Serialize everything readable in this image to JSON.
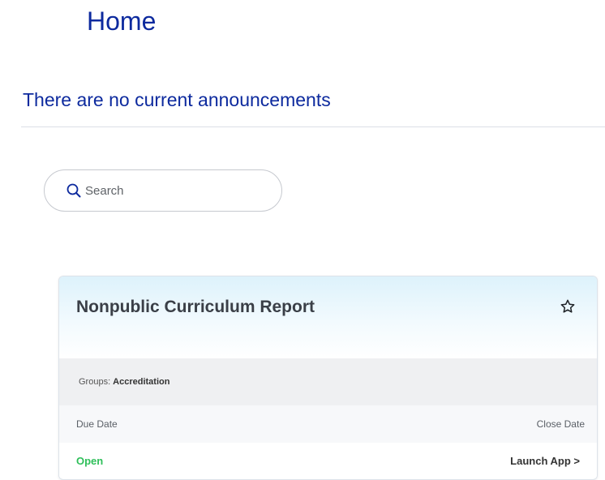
{
  "page": {
    "title": "Home"
  },
  "announcements": {
    "message": "There are no current announcements"
  },
  "search": {
    "placeholder": "Search",
    "value": "",
    "icon": "search-icon"
  },
  "app_card": {
    "title": "Nonpublic Curriculum Report",
    "favorite_icon": "star-outline-icon",
    "groups_label": "Groups:",
    "groups_value": "Accreditation",
    "due_date_label": "Due Date",
    "close_date_label": "Close Date",
    "status": "Open",
    "launch_label": "Launch App >"
  },
  "colors": {
    "heading": "#0d2a9e",
    "status_open": "#2fbf5a"
  }
}
